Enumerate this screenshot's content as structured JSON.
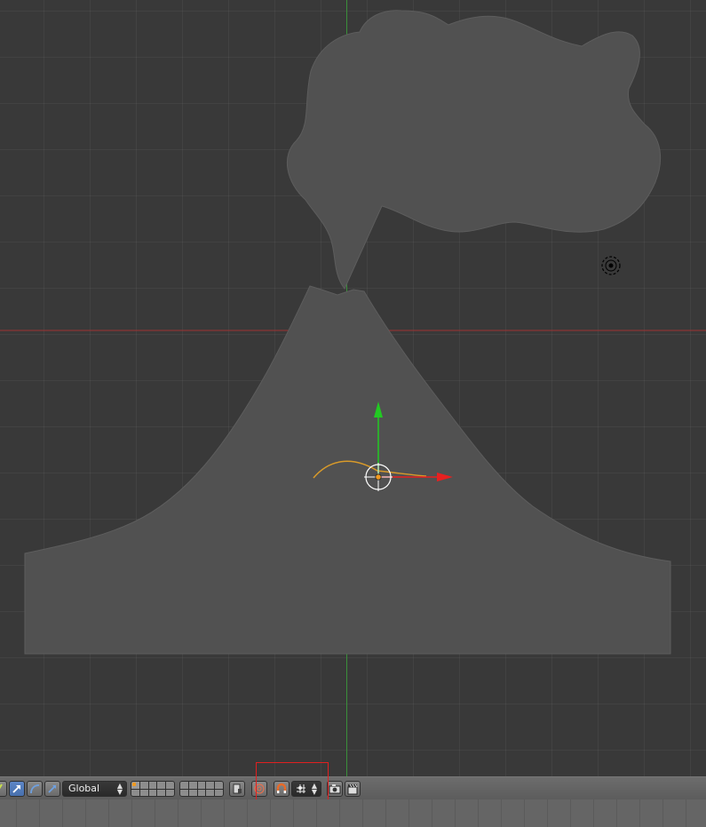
{
  "viewport": {
    "background_color": "#393939",
    "x_axis_color": "#b03434",
    "y_axis_color": "#3e9e3e",
    "object_color": "#515151"
  },
  "header": {
    "transform_orientation": {
      "selected": "Global"
    },
    "tools": {
      "manipulator_translate_icon": "translate-arrow-icon",
      "manipulator_rotate_icon": "rotate-arc-icon",
      "manipulator_scale_icon": "scale-arrow-icon",
      "snap_icon": "magnet-icon",
      "snap_element_icon": "snap-increment-icon",
      "render_icon": "camera-icon",
      "animation_render_icon": "clapperboard-icon"
    },
    "colors": {
      "active_button": "#5a82c2",
      "highlight_box": "#e02020",
      "origin_dot": "#f09a20"
    }
  }
}
